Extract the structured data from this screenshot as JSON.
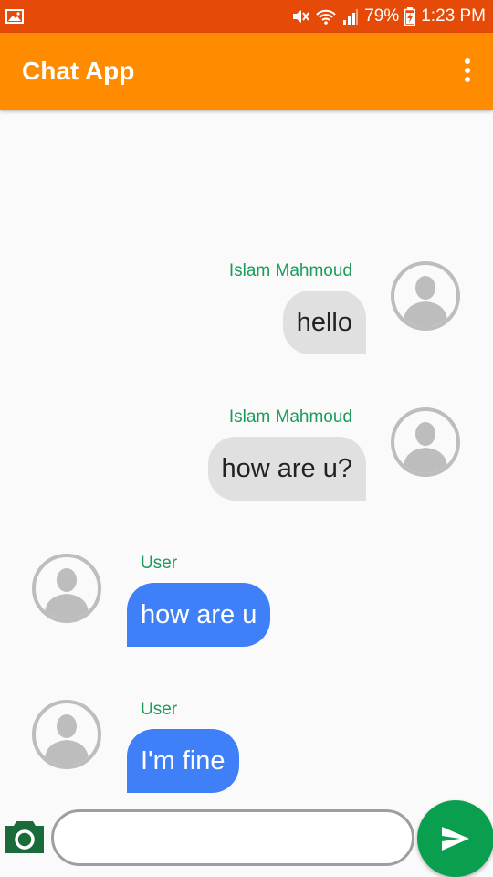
{
  "status_bar": {
    "battery_percent": "79%",
    "time": "1:23 PM",
    "icons": [
      "gallery-icon",
      "mute-icon",
      "wifi-icon",
      "signal-icon",
      "battery-charging-icon"
    ]
  },
  "app_bar": {
    "title": "Chat App",
    "menu_icon": "more-vert-icon"
  },
  "messages": [
    {
      "sender": "Islam Mahmoud",
      "text": "hello",
      "direction": "incoming"
    },
    {
      "sender": "Islam Mahmoud",
      "text": "how are u?",
      "direction": "incoming"
    },
    {
      "sender": "User",
      "text": "how are u",
      "direction": "outgoing"
    },
    {
      "sender": "User",
      "text": "I'm fine",
      "direction": "outgoing"
    }
  ],
  "composer": {
    "input_value": "",
    "camera_icon": "camera-icon",
    "send_icon": "send-icon"
  },
  "colors": {
    "status_bar": "#e64a08",
    "app_bar": "#ff8c00",
    "sender_name": "#1a9b5a",
    "incoming_bubble": "#e0e0e0",
    "outgoing_bubble": "#3f80f8",
    "send_button": "#0a9f4e",
    "camera": "#1b6b3a"
  }
}
